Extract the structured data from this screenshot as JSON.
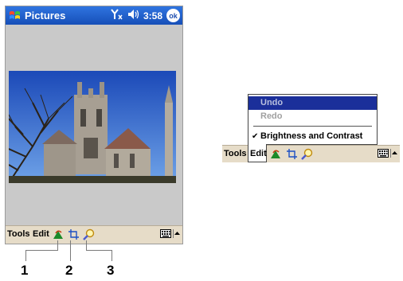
{
  "device": {
    "app_title": "Pictures",
    "time": "3:58",
    "ok_label": "ok",
    "signal_label": "¥ₓ",
    "volume_label": "◄€"
  },
  "menubar": {
    "tools_label": "Tools",
    "edit_label": "Edit"
  },
  "callouts": [
    "1",
    "2",
    "3"
  ],
  "edit_menu": {
    "items": [
      {
        "label": "Undo",
        "state": "selected"
      },
      {
        "label": "Redo",
        "state": "disabled"
      },
      {
        "label": "Brightness and Contrast",
        "state": "checked",
        "check": "✔"
      }
    ]
  },
  "icons": {
    "start": "windows-flag-icon",
    "crop": "crop-icon",
    "zoom": "magnifier-icon",
    "rotate": "rotate-icon",
    "keyboard": "keyboard-icon"
  }
}
